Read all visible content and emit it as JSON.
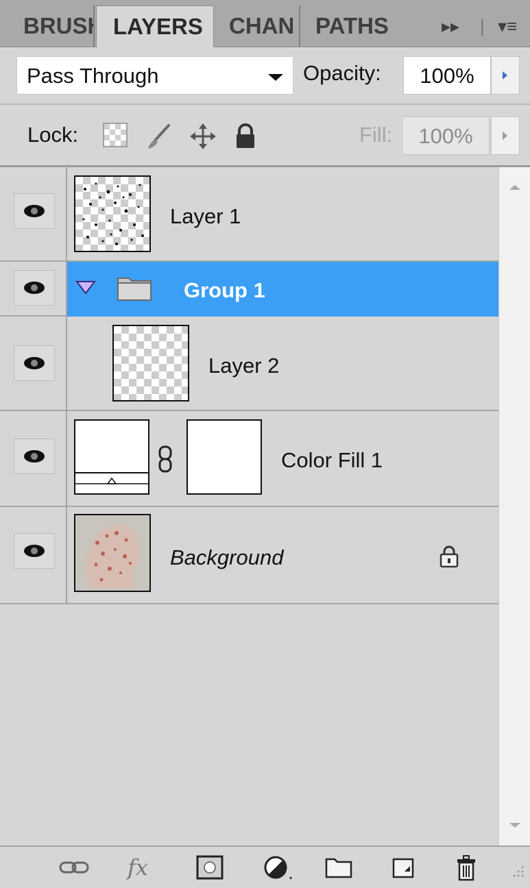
{
  "tabs": [
    {
      "label": "BRUSH",
      "active": false
    },
    {
      "label": "LAYERS",
      "active": true
    },
    {
      "label": "CHAN",
      "active": false
    },
    {
      "label": "PATHS",
      "active": false
    }
  ],
  "tab_controls": {
    "expand_glyph": "▸▸",
    "divider": "|",
    "menu_glyph": "▾≡"
  },
  "blend": {
    "mode": "Pass Through"
  },
  "opacity": {
    "label": "Opacity:",
    "value": "100%"
  },
  "lock": {
    "label": "Lock:",
    "icons": [
      "lock-transparent-icon",
      "lock-paint-icon",
      "lock-move-icon",
      "lock-all-icon"
    ]
  },
  "fill": {
    "label": "Fill:",
    "value": "100%",
    "disabled": true
  },
  "layers": [
    {
      "name": "Layer 1",
      "type": "pixel",
      "visible": true,
      "selected": false
    },
    {
      "name": "Group 1",
      "type": "group",
      "visible": true,
      "selected": true,
      "expanded": true
    },
    {
      "name": "Layer 2",
      "type": "pixel",
      "visible": true,
      "selected": false,
      "in_group": "Group 1"
    },
    {
      "name": "Color Fill 1",
      "type": "fill",
      "visible": true,
      "selected": false,
      "linked_mask": true
    },
    {
      "name": "Background",
      "type": "background",
      "visible": true,
      "selected": false,
      "locked": true
    }
  ],
  "colors": {
    "selection": "#3b9ff5",
    "panel": "#d6d6d6",
    "tab_bar": "#a9a9a9",
    "spin_arrow": "#3b6fc6"
  },
  "bottom_tools": [
    "link-layers-icon",
    "fx-icon",
    "add-mask-icon",
    "adjustment-layer-icon",
    "new-group-icon",
    "new-layer-icon",
    "delete-icon"
  ],
  "bottom_labels": {
    "fx": "fx"
  }
}
